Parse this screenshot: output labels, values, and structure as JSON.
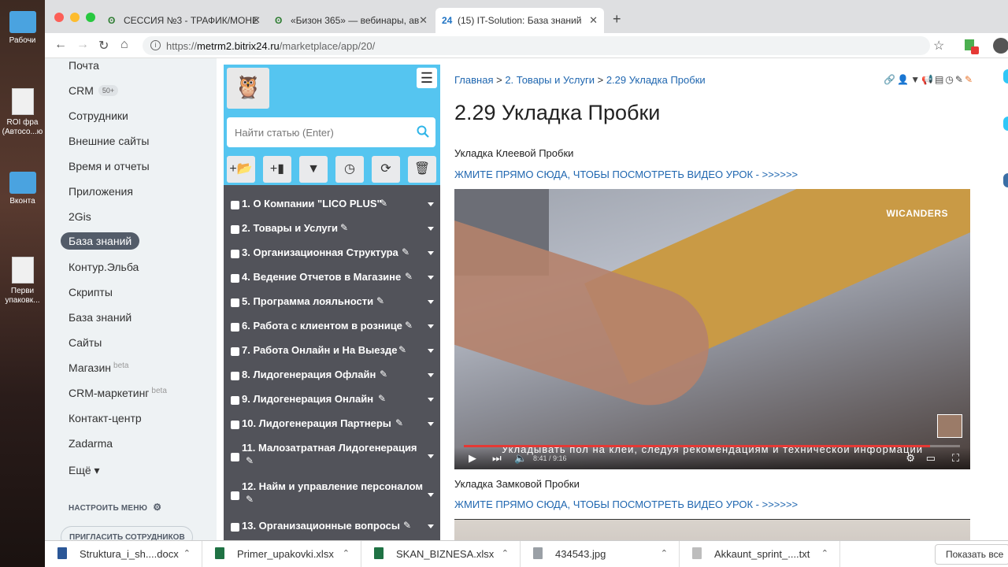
{
  "desktop": {
    "items": [
      "Рабочи",
      "ROI фра (Автосо...ю",
      "Вконта",
      "Перви упаковк..."
    ]
  },
  "tabs": [
    {
      "title": "СЕССИЯ №3 - ТРАФИК/МОНЕ",
      "icon": "ʘ"
    },
    {
      "title": "«Бизон 365» — вебинары, ав",
      "icon": "ʘ"
    },
    {
      "title": "(15) IT-Solution: База знаний",
      "icon": "24"
    }
  ],
  "address": {
    "host": "metrm2.bitrix24.ru",
    "path": "/marketplace/app/20/",
    "scheme": "https://"
  },
  "leftmenu": {
    "items": [
      "Почта",
      "CRM",
      "Сотрудники",
      "Внешние сайты",
      "Время и отчеты",
      "Приложения",
      "2Gis",
      "База знаний",
      "Контур.Эльба",
      "Скрипты",
      "База знаний",
      "Сайты",
      "Магазин",
      "CRM-маркетинг",
      "Контакт-центр",
      "Zadarma",
      "Ещё ▾"
    ],
    "crm_counter": "50+",
    "beta": "beta",
    "configure": "НАСТРОИТЬ МЕНЮ",
    "invite": "ПРИГЛАСИТЬ СОТРУДНИКОВ"
  },
  "kb": {
    "search_placeholder": "Найти статью (Enter)",
    "items": [
      "1. О Компании \"LICO PLUS\"",
      "2. Товары и Услуги",
      "3. Организационная Структура",
      "4. Ведение Отчетов в Магазине",
      "5. Программа лояльности",
      "6. Работа с клиентом в рознице",
      "7. Работа Онлайн и На Выезде",
      "8. Лидогенерация Офлайн",
      "9. Лидогенерация Онлайн",
      "10. Лидогенерация Партнеры",
      "11. Малозатратная Лидогенерация",
      "12. Найм и управление персоналом",
      "13. Организационные вопросы"
    ]
  },
  "article": {
    "crumb_home": "Главная",
    "crumb_section": "2. Товары и Услуги",
    "crumb_current": "2.29 Укладка Пробки",
    "title": "2.29 Укладка Пробки",
    "p1": "Укладка Клеевой Пробки",
    "link1": "ЖМИТЕ ПРЯМО СЮДА, ЧТОБЫ ПОСМОТРЕТЬ ВИДЕО УРОК - >>>>>>",
    "p2": "Укладка Замковой Пробки",
    "link2": "ЖМИТЕ ПРЯМО СЮДА, ЧТОБЫ ПОСМОТРЕТЬ ВИДЕО УРОК - >>>>>>"
  },
  "video": {
    "brand": "WICANDERS",
    "subtitle": "Укладывать пол на клей, следуя рекомендациям и технической информации",
    "time": "8:41 / 9:16",
    "progress": 0.94
  },
  "downloads": [
    {
      "name": "Struktura_i_sh....docx",
      "color": "#2b5797"
    },
    {
      "name": "Primer_upakovki.xlsx",
      "color": "#1f7244"
    },
    {
      "name": "SKAN_BIZNESA.xlsx",
      "color": "#1f7244"
    },
    {
      "name": "434543.jpg",
      "color": "#9aa0a6"
    },
    {
      "name": "Akkaunt_sprint_....txt",
      "color": "#bdbdbd"
    }
  ],
  "show_all": "Показать все"
}
